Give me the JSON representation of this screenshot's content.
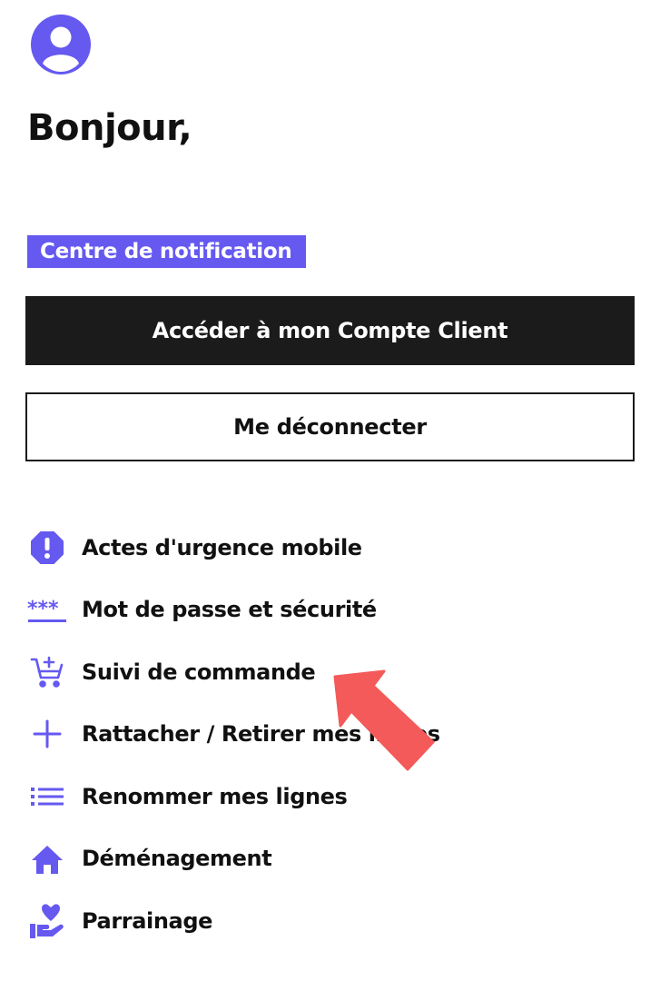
{
  "colors": {
    "accent": "#6559f0",
    "primary_button_bg": "#1b1b1b",
    "annotation_arrow": "#f45a5a"
  },
  "header": {
    "avatar_icon": "user-circle-icon",
    "greeting": "Bonjour,"
  },
  "notification_center": {
    "label": "Centre de notification"
  },
  "buttons": {
    "account": "Accéder à mon Compte Client",
    "logout": "Me déconnecter"
  },
  "menu": [
    {
      "label": "Actes d'urgence mobile",
      "icon": "alert-octagon-icon"
    },
    {
      "label": "Mot de passe et sécurité",
      "icon": "password-asterisk-icon"
    },
    {
      "label": "Suivi de commande",
      "icon": "cart-add-icon"
    },
    {
      "label": "Rattacher / Retirer mes lignes",
      "icon": "plus-icon"
    },
    {
      "label": "Renommer mes lignes",
      "icon": "list-icon"
    },
    {
      "label": "Déménagement",
      "icon": "home-icon"
    },
    {
      "label": "Parrainage",
      "icon": "hand-heart-icon"
    }
  ],
  "annotation": {
    "icon": "red-arrow-pointer"
  }
}
